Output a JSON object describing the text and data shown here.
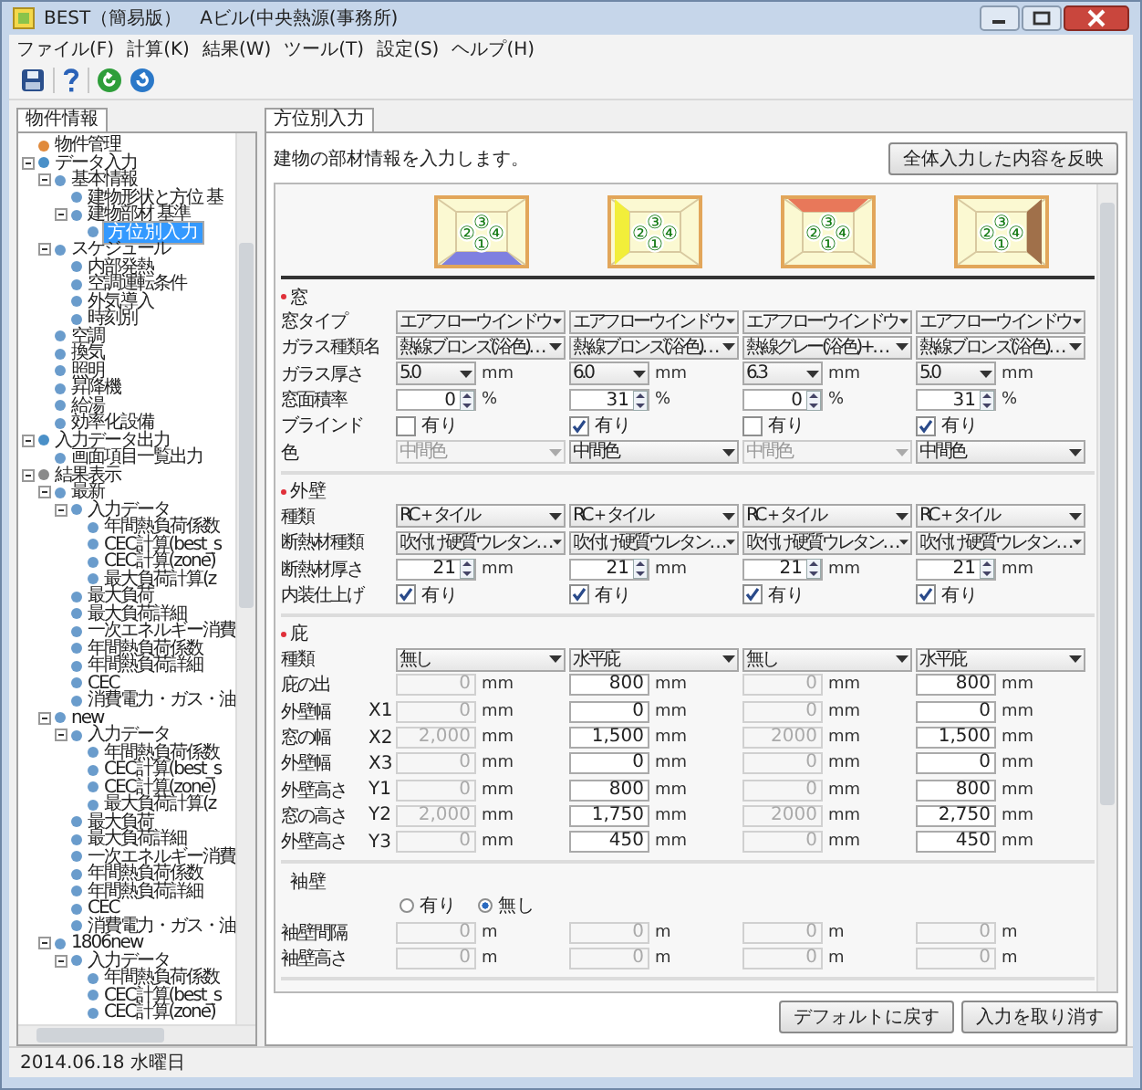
{
  "window": {
    "title": "BEST（簡易版）　Aビル(中央熱源(事務所)"
  },
  "menu": [
    "ファイル(F)",
    "計算(K)",
    "結果(W)",
    "ツール(T)",
    "設定(S)",
    "ヘルプ(H)"
  ],
  "project_panel": {
    "tab": {
      "label": "物件情報",
      "selected": true
    },
    "tree": [
      {
        "label": "物件管理",
        "color": "#e08a3c",
        "selected": false
      },
      {
        "label": "データ入力",
        "color": "#4a90c8",
        "selected": false,
        "expanded": true,
        "children": [
          {
            "label": "基本情報",
            "selected": false,
            "expanded": true,
            "children": [
              {
                "label": "建物形状と方位 基",
                "selected": false
              },
              {
                "label": "建物部材 基準",
                "selected": false,
                "expanded": true,
                "children": [
                  {
                    "label": "方位別入力",
                    "selected": true
                  }
                ]
              }
            ]
          },
          {
            "label": "スケジュール",
            "selected": false,
            "expanded": true,
            "children": [
              {
                "label": "内部発熱",
                "selected": false
              },
              {
                "label": "空調運転条件",
                "selected": false
              },
              {
                "label": "外気導入",
                "selected": false
              },
              {
                "label": "時刻別",
                "selected": false
              }
            ]
          },
          {
            "label": "空調",
            "selected": false
          },
          {
            "label": "換気",
            "selected": false
          },
          {
            "label": "照明",
            "selected": false
          },
          {
            "label": "昇降機",
            "selected": false
          },
          {
            "label": "給湯",
            "selected": false
          },
          {
            "label": "効率化設備",
            "selected": false
          }
        ]
      },
      {
        "label": "入力データ出力",
        "color": "#4a90c8",
        "selected": false,
        "expanded": true,
        "children": [
          {
            "label": "画面項目一覧出力",
            "selected": false
          }
        ]
      },
      {
        "label": "結果表示",
        "color": "#8a8a8a",
        "selected": false,
        "expanded": true,
        "children": [
          {
            "label": "最新",
            "selected": false,
            "expanded": true,
            "children": [
              {
                "label": "入力データ",
                "selected": false,
                "expanded": true,
                "children": [
                  {
                    "label": "年間熱負荷係数",
                    "selected": false
                  },
                  {
                    "label": "CEC計算(best_s",
                    "selected": false
                  },
                  {
                    "label": "CEC計算(zone)",
                    "selected": false
                  },
                  {
                    "label": "最大負荷計算(z",
                    "selected": false
                  }
                ]
              },
              {
                "label": "最大負荷",
                "selected": false
              },
              {
                "label": "最大負荷詳細",
                "selected": false
              },
              {
                "label": "一次エネルギー消費",
                "selected": false
              },
              {
                "label": "年間熱負荷係数",
                "selected": false
              },
              {
                "label": "年間熱負荷詳細",
                "selected": false
              },
              {
                "label": "CEC",
                "selected": false
              },
              {
                "label": "消費電力・ガス・油",
                "selected": false
              }
            ]
          },
          {
            "label": "new",
            "selected": false,
            "expanded": true,
            "children": [
              {
                "label": "入力データ",
                "selected": false,
                "expanded": true,
                "children": [
                  {
                    "label": "年間熱負荷係数",
                    "selected": false
                  },
                  {
                    "label": "CEC計算(best_s",
                    "selected": false
                  },
                  {
                    "label": "CEC計算(zone)",
                    "selected": false
                  },
                  {
                    "label": "最大負荷計算(z",
                    "selected": false
                  }
                ]
              },
              {
                "label": "最大負荷",
                "selected": false
              },
              {
                "label": "最大負荷詳細",
                "selected": false
              },
              {
                "label": "一次エネルギー消費",
                "selected": false
              },
              {
                "label": "年間熱負荷係数",
                "selected": false
              },
              {
                "label": "年間熱負荷詳細",
                "selected": false
              },
              {
                "label": "CEC",
                "selected": false
              },
              {
                "label": "消費電力・ガス・油",
                "selected": false
              }
            ]
          },
          {
            "label": "1806new",
            "selected": false,
            "expanded": true,
            "children": [
              {
                "label": "入力データ",
                "selected": false,
                "expanded": true,
                "children": [
                  {
                    "label": "年間熱負荷係数",
                    "selected": false
                  },
                  {
                    "label": "CEC計算(best_s",
                    "selected": false
                  },
                  {
                    "label": "CEC計算(zone)",
                    "selected": false
                  }
                ]
              }
            ]
          }
        ]
      }
    ]
  },
  "main_panel": {
    "tab": {
      "label": "方位別入力",
      "selected": true
    },
    "description": "建物の部材情報を入力します。",
    "apply_button": "全体入力した内容を反映",
    "orientations": [
      {
        "kind": "bottom",
        "color": "#7f80e0",
        "top": "③",
        "left": "②",
        "right": "④",
        "bottom": "①"
      },
      {
        "kind": "left",
        "color": "#f2ee3a",
        "top": "③",
        "left": "②",
        "right": "④",
        "bottom": "①"
      },
      {
        "kind": "top",
        "color": "#e8785a",
        "top": "③",
        "left": "②",
        "right": "④",
        "bottom": "①"
      },
      {
        "kind": "right",
        "color": "#a0704a",
        "top": "③",
        "left": "②",
        "right": "④",
        "bottom": "①"
      }
    ],
    "sections": [
      {
        "title": "窓",
        "marked": true,
        "rows": [
          {
            "label": "窓タイプ",
            "kind": "select",
            "cells": [
              {
                "value": "エアフローウインドウ",
                "disabled": false
              },
              {
                "value": "エアフローウインドウ",
                "disabled": false
              },
              {
                "value": "エアフローウインドウ",
                "disabled": false
              },
              {
                "value": "エアフローウインドウ",
                "disabled": false
              }
            ]
          },
          {
            "label": "ガラス種類名",
            "kind": "select",
            "cells": [
              {
                "value": "熱線ブロンズ(浴色)…",
                "disabled": false
              },
              {
                "value": "熱線ブロンズ(浴色)…",
                "disabled": false
              },
              {
                "value": "熱線グレー(浴色)+…",
                "disabled": false
              },
              {
                "value": "熱線ブロンズ(浴色)…",
                "disabled": false
              }
            ]
          },
          {
            "label": "ガラス厚さ",
            "kind": "select_unit",
            "cells": [
              {
                "value": "5.0",
                "unit": "mm",
                "disabled": false
              },
              {
                "value": "6.0",
                "unit": "mm",
                "disabled": false
              },
              {
                "value": "6.3",
                "unit": "mm",
                "disabled": false
              },
              {
                "value": "5.0",
                "unit": "mm",
                "disabled": false
              }
            ]
          },
          {
            "label": "窓面積率",
            "kind": "spin",
            "cells": [
              {
                "value": "0",
                "unit": "%"
              },
              {
                "value": "31",
                "unit": "%"
              },
              {
                "value": "0",
                "unit": "%"
              },
              {
                "value": "31",
                "unit": "%"
              }
            ]
          },
          {
            "label": "ブラインド",
            "kind": "check",
            "cells": [
              {
                "label": "有り",
                "checked": false
              },
              {
                "label": "有り",
                "checked": true
              },
              {
                "label": "有り",
                "checked": false
              },
              {
                "label": "有り",
                "checked": true
              }
            ]
          },
          {
            "label": "色",
            "kind": "select",
            "cells": [
              {
                "value": "中間色",
                "disabled": true
              },
              {
                "value": "中間色",
                "disabled": false
              },
              {
                "value": "中間色",
                "disabled": true
              },
              {
                "value": "中間色",
                "disabled": false
              }
            ]
          }
        ]
      },
      {
        "title": "外壁",
        "marked": true,
        "rows": [
          {
            "label": "種類",
            "kind": "select",
            "cells": [
              {
                "value": "RC＋タイル",
                "disabled": false
              },
              {
                "value": "RC＋タイル",
                "disabled": false
              },
              {
                "value": "RC＋タイル",
                "disabled": false
              },
              {
                "value": "RC＋タイル",
                "disabled": false
              }
            ]
          },
          {
            "label": "断熱材種類",
            "kind": "select",
            "cells": [
              {
                "value": "吹付け硬質ウレタン…",
                "disabled": false
              },
              {
                "value": "吹付け硬質ウレタン…",
                "disabled": false
              },
              {
                "value": "吹付け硬質ウレタン…",
                "disabled": false
              },
              {
                "value": "吹付け硬質ウレタン…",
                "disabled": false
              }
            ]
          },
          {
            "label": "断熱材厚さ",
            "kind": "spin",
            "cells": [
              {
                "value": "21",
                "unit": "mm"
              },
              {
                "value": "21",
                "unit": "mm"
              },
              {
                "value": "21",
                "unit": "mm"
              },
              {
                "value": "21",
                "unit": "mm"
              }
            ]
          },
          {
            "label": "内装仕上げ",
            "kind": "check",
            "cells": [
              {
                "label": "有り",
                "checked": true
              },
              {
                "label": "有り",
                "checked": true
              },
              {
                "label": "有り",
                "checked": true
              },
              {
                "label": "有り",
                "checked": true
              }
            ]
          }
        ]
      },
      {
        "title": "庇",
        "marked": true,
        "rows": [
          {
            "label": "種類",
            "kind": "select",
            "cells": [
              {
                "value": "無し",
                "disabled": false
              },
              {
                "value": "水平庇",
                "disabled": false
              },
              {
                "value": "無し",
                "disabled": false
              },
              {
                "value": "水平庇",
                "disabled": false
              }
            ]
          },
          {
            "label": "庇の出",
            "kind": "number",
            "cells": [
              {
                "value": "0",
                "unit": "mm",
                "disabled": true
              },
              {
                "value": "800",
                "unit": "mm",
                "disabled": false
              },
              {
                "value": "0",
                "unit": "mm",
                "disabled": true
              },
              {
                "value": "800",
                "unit": "mm",
                "disabled": false
              }
            ]
          },
          {
            "label": "外壁幅",
            "sublabel": "X1",
            "kind": "number",
            "cells": [
              {
                "value": "0",
                "unit": "mm",
                "disabled": true
              },
              {
                "value": "0",
                "unit": "mm",
                "disabled": false
              },
              {
                "value": "0",
                "unit": "mm",
                "disabled": true
              },
              {
                "value": "0",
                "unit": "mm",
                "disabled": false
              }
            ]
          },
          {
            "label": "窓の幅",
            "sublabel": "X2",
            "kind": "number",
            "cells": [
              {
                "value": "2,000",
                "unit": "mm",
                "disabled": true
              },
              {
                "value": "1,500",
                "unit": "mm",
                "disabled": false
              },
              {
                "value": "2000",
                "unit": "mm",
                "disabled": true
              },
              {
                "value": "1,500",
                "unit": "mm",
                "disabled": false
              }
            ]
          },
          {
            "label": "外壁幅",
            "sublabel": "X3",
            "kind": "number",
            "cells": [
              {
                "value": "0",
                "unit": "mm",
                "disabled": true
              },
              {
                "value": "0",
                "unit": "mm",
                "disabled": false
              },
              {
                "value": "0",
                "unit": "mm",
                "disabled": true
              },
              {
                "value": "0",
                "unit": "mm",
                "disabled": false
              }
            ]
          },
          {
            "label": "外壁高さ",
            "sublabel": "Y1",
            "kind": "number",
            "cells": [
              {
                "value": "0",
                "unit": "mm",
                "disabled": true
              },
              {
                "value": "800",
                "unit": "mm",
                "disabled": false
              },
              {
                "value": "0",
                "unit": "mm",
                "disabled": true
              },
              {
                "value": "800",
                "unit": "mm",
                "disabled": false
              }
            ]
          },
          {
            "label": "窓の高さ",
            "sublabel": "Y2",
            "kind": "number",
            "cells": [
              {
                "value": "2,000",
                "unit": "mm",
                "disabled": true
              },
              {
                "value": "1,750",
                "unit": "mm",
                "disabled": false
              },
              {
                "value": "2000",
                "unit": "mm",
                "disabled": true
              },
              {
                "value": "2,750",
                "unit": "mm",
                "disabled": false
              }
            ]
          },
          {
            "label": "外壁高さ",
            "sublabel": "Y3",
            "kind": "number",
            "cells": [
              {
                "value": "0",
                "unit": "mm",
                "disabled": true
              },
              {
                "value": "450",
                "unit": "mm",
                "disabled": false
              },
              {
                "value": "0",
                "unit": "mm",
                "disabled": true
              },
              {
                "value": "450",
                "unit": "mm",
                "disabled": false
              }
            ]
          }
        ]
      },
      {
        "title": "袖壁",
        "marked": false,
        "rows": [
          {
            "kind": "radio",
            "options": [
              {
                "label": "有り",
                "selected": false
              },
              {
                "label": "無し",
                "selected": true
              }
            ]
          },
          {
            "label": "袖壁間隔",
            "kind": "number",
            "cells": [
              {
                "value": "0",
                "unit": "m",
                "disabled": true
              },
              {
                "value": "0",
                "unit": "m",
                "disabled": true
              },
              {
                "value": "0",
                "unit": "m",
                "disabled": true
              },
              {
                "value": "0",
                "unit": "m",
                "disabled": true
              }
            ]
          },
          {
            "label": "袖壁高さ",
            "kind": "number",
            "cells": [
              {
                "value": "0",
                "unit": "m",
                "disabled": true
              },
              {
                "value": "0",
                "unit": "m",
                "disabled": true
              },
              {
                "value": "0",
                "unit": "m",
                "disabled": true
              },
              {
                "value": "0",
                "unit": "m",
                "disabled": true
              }
            ]
          }
        ]
      }
    ],
    "buttons": [
      "デフォルトに戻す",
      "入力を取り消す"
    ]
  },
  "status_bar": "2014.06.18 水曜日"
}
